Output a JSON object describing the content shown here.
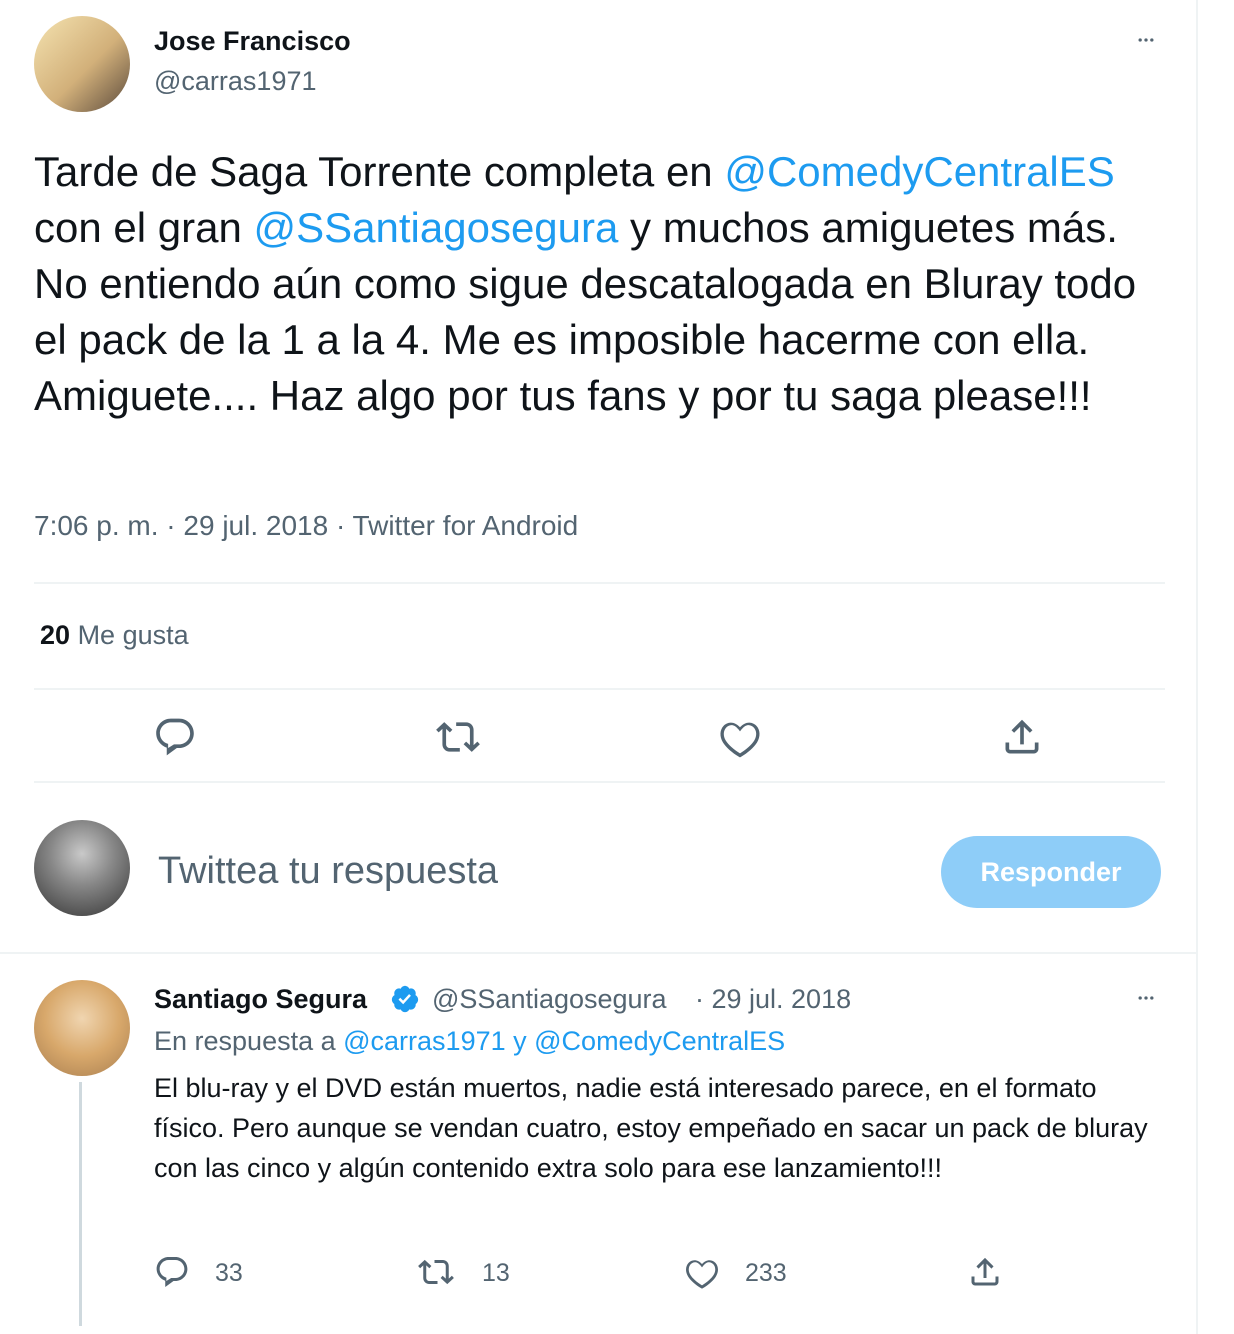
{
  "main_tweet": {
    "author_name": "Jose Francisco",
    "author_handle": "@carras1971",
    "text_parts": {
      "p1": "Tarde de Saga Torrente completa en ",
      "m1": "@ComedyCentralES",
      "p2": " con el gran ",
      "m2": "@SSantiagosegura",
      "p3": " y muchos amiguetes más. No entiendo aún como sigue descatalogada en Bluray todo el pack de la 1 a la 4. Me es imposible hacerme con ella. Amiguete.... Haz algo por tus fans y por tu saga please!!!"
    },
    "meta": "7:06 p. m. · 29 jul. 2018 · Twitter for Android",
    "likes_count": "20",
    "likes_label": "Me gusta"
  },
  "reply_box": {
    "placeholder": "Twittea tu respuesta",
    "button_label": "Responder"
  },
  "reply_tweet": {
    "author_name": "Santiago Segura",
    "author_handle": "@SSantiagosegura",
    "date": "· 29 jul. 2018",
    "in_reply_prefix": "En respuesta a ",
    "in_reply_m1": "@carras1971",
    "in_reply_and": " y ",
    "in_reply_m2": "@ComedyCentralES",
    "text": "El blu-ray y el DVD están muertos, nadie está interesado parece, en el formato físico. Pero aunque se vendan cuatro, estoy empeñado en sacar un pack de bluray con las cinco y algún contenido extra solo para ese lanzamiento!!!",
    "reply_count": "33",
    "retweet_count": "13",
    "like_count": "233"
  },
  "icons": {
    "more": "more-icon",
    "reply": "reply-icon",
    "retweet": "retweet-icon",
    "like": "heart-icon",
    "share": "share-icon",
    "verified": "verified-badge-icon"
  },
  "colors": {
    "accent": "#1d9bf0",
    "muted_text": "#536471",
    "button_disabled": "#8ecdf8"
  }
}
